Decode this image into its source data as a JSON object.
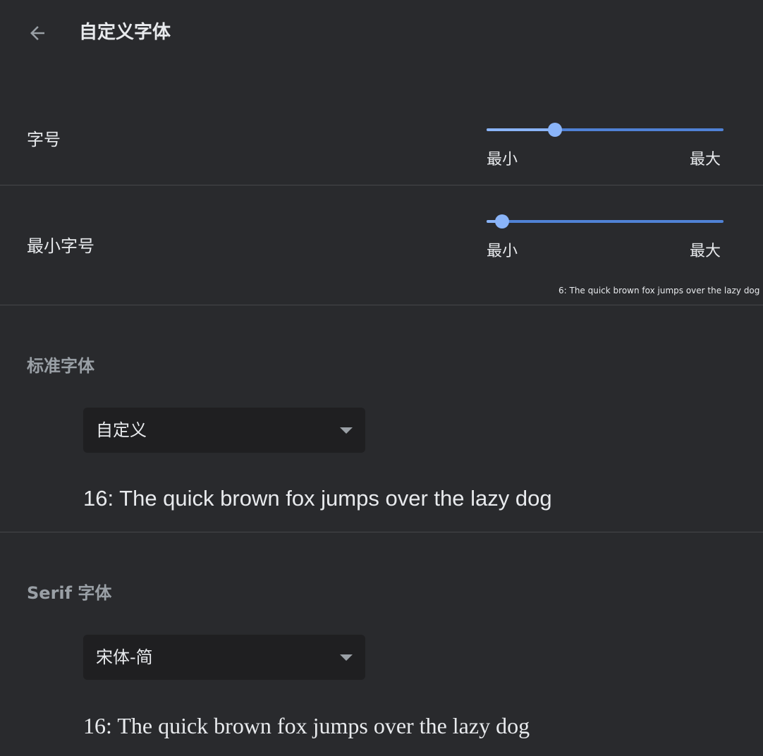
{
  "header": {
    "title": "自定义字体",
    "back_icon": "arrow-back-icon"
  },
  "font_size": {
    "label": "字号",
    "min_label": "最小",
    "max_label": "最大",
    "value_fraction": 0.29
  },
  "min_font_size": {
    "label": "最小字号",
    "min_label": "最小",
    "max_label": "最大",
    "value_fraction": 0.066,
    "sample_text": "6: The quick brown fox jumps over the lazy dog"
  },
  "standard_font": {
    "title": "标准字体",
    "selected": "自定义",
    "sample_text": "16: The quick brown fox jumps over the lazy dog"
  },
  "serif_font": {
    "title": "Serif 字体",
    "selected": "宋体-简",
    "sample_text": "16: The quick brown fox jumps over the lazy dog"
  },
  "colors": {
    "background": "#292a2d",
    "accent": "#8ab4f8",
    "track": "#5082d6",
    "muted_text": "#9aa0a6"
  }
}
